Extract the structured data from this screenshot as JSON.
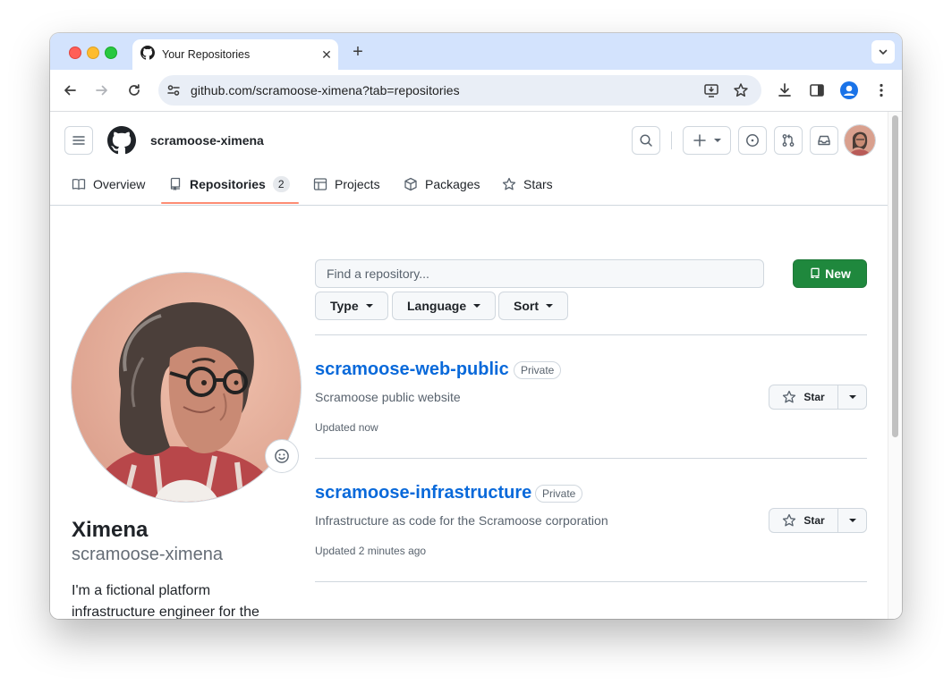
{
  "browser": {
    "tab_title": "Your Repositories",
    "close_glyph": "✕",
    "new_tab_glyph": "+",
    "url_host": "github.com",
    "url_path": "/scramoose-ximena?tab=repositories"
  },
  "header": {
    "username": "scramoose-ximena"
  },
  "nav": {
    "overview": "Overview",
    "repositories": "Repositories",
    "repositories_count": "2",
    "projects": "Projects",
    "packages": "Packages",
    "stars": "Stars"
  },
  "profile": {
    "name": "Ximena",
    "login": "scramoose-ximena",
    "bio": "I'm a fictional platform infrastructure engineer for the fictional company Scramoose."
  },
  "repos_toolbar": {
    "search_placeholder": "Find a repository...",
    "new_label": "New",
    "type_label": "Type",
    "language_label": "Language",
    "sort_label": "Sort"
  },
  "repos": [
    {
      "name": "scramoose-web-public",
      "visibility": "Private",
      "description": "Scramoose public website",
      "updated": "Updated now",
      "star_label": "Star"
    },
    {
      "name": "scramoose-infrastructure",
      "visibility": "Private",
      "description": "Infrastructure as code for the Scramoose corporation",
      "updated": "Updated 2 minutes ago",
      "star_label": "Star"
    }
  ],
  "colors": {
    "accent_link": "#0969da",
    "new_button": "#1f883d",
    "tab_underline": "#fd8c73",
    "tabstrip": "#d3e3fd"
  }
}
